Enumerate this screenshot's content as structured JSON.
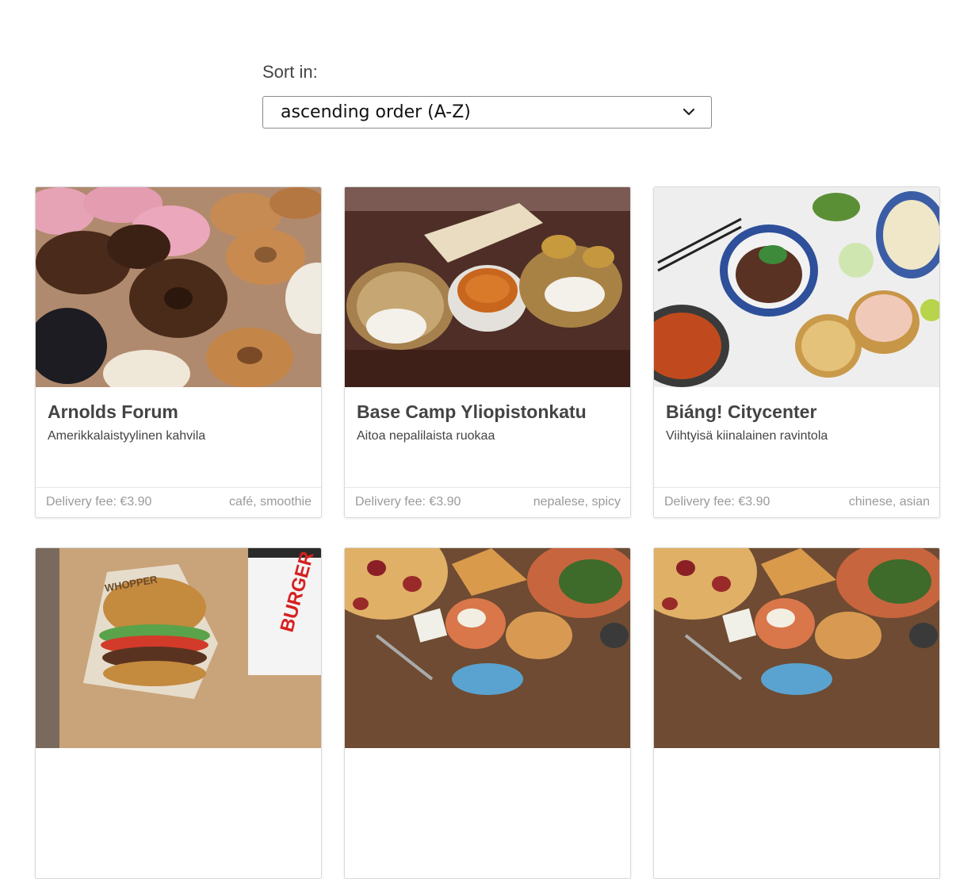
{
  "sort": {
    "label": "Sort in:",
    "selected": "ascending order (A-Z)"
  },
  "restaurants": [
    {
      "name": "Arnolds Forum",
      "description": "Amerikkalaistyylinen kahvila",
      "delivery_fee": "Delivery fee: €3.90",
      "tags": "café, smoothie",
      "image": "donuts-photo"
    },
    {
      "name": "Base Camp Yliopistonkatu",
      "description": "Aitoa nepalilaista ruokaa",
      "delivery_fee": "Delivery fee: €3.90",
      "tags": "nepalese, spicy",
      "image": "nepalese-thali-photo"
    },
    {
      "name": "Biáng! Citycenter",
      "description": "Viihtyisä kiinalainen ravintola",
      "delivery_fee": "Delivery fee: €3.90",
      "tags": "chinese, asian",
      "image": "chinese-dishes-photo"
    },
    {
      "image": "burger-king-photo",
      "image_text": "BURGER KING",
      "wrapper_text": "WHOPPER"
    },
    {
      "image": "pizza-table-photo"
    },
    {
      "image": "pizza-table-photo"
    }
  ]
}
